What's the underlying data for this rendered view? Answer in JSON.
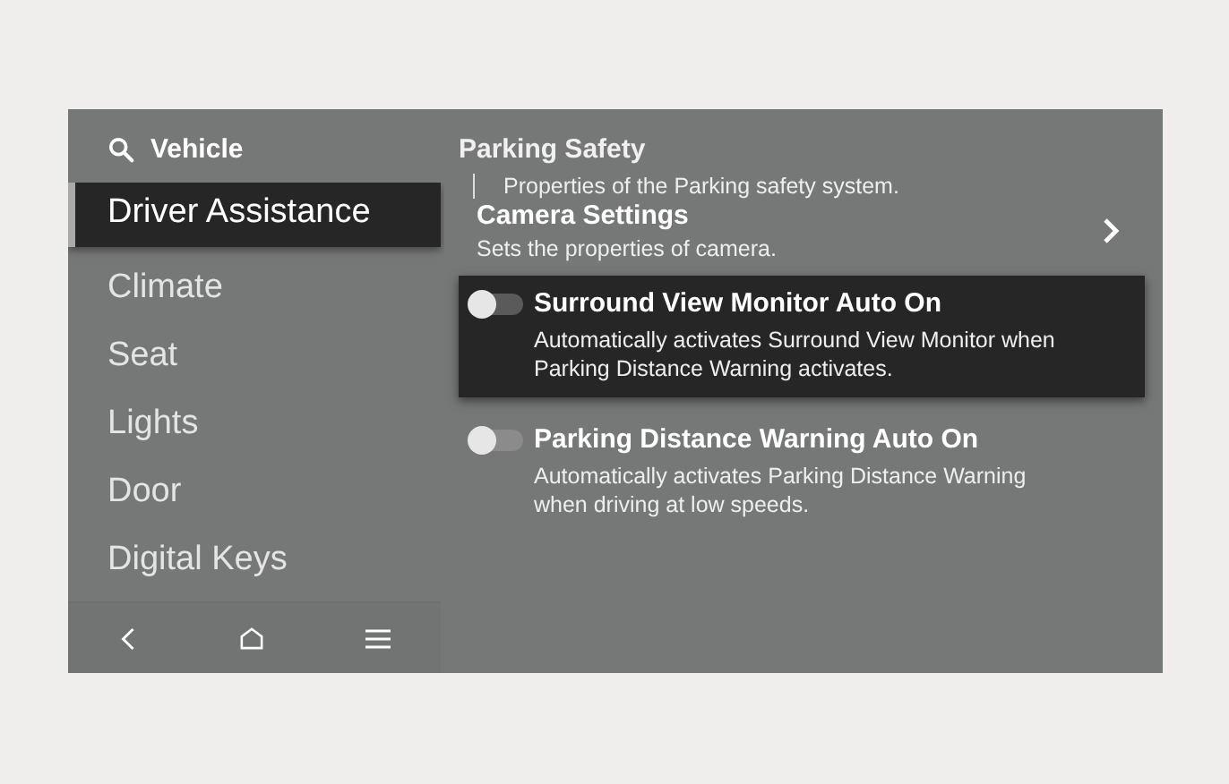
{
  "sidebar": {
    "search_label": "Vehicle",
    "items": [
      {
        "label": "Driver Assistance",
        "selected": true
      },
      {
        "label": "Climate",
        "selected": false
      },
      {
        "label": "Seat",
        "selected": false
      },
      {
        "label": "Lights",
        "selected": false
      },
      {
        "label": "Door",
        "selected": false
      },
      {
        "label": "Digital Keys",
        "selected": false
      }
    ]
  },
  "nav_bar": {
    "buttons": [
      {
        "kind": "back"
      },
      {
        "kind": "home"
      },
      {
        "kind": "menu"
      }
    ]
  },
  "section": {
    "title": "Parking Safety",
    "description": "Properties of the Parking safety system."
  },
  "camera_settings": {
    "title": "Camera Settings",
    "description": "Sets the properties of camera."
  },
  "options": [
    {
      "title": "Surround View Monitor Auto On",
      "description": "Automatically activates Surround View Monitor when Parking Distance Warning activates.",
      "on": false,
      "selected": true
    },
    {
      "title": "Parking Distance Warning Auto On",
      "description": "Automatically activates Parking Distance Warning when driving at low speeds.",
      "on": false,
      "selected": false
    }
  ]
}
